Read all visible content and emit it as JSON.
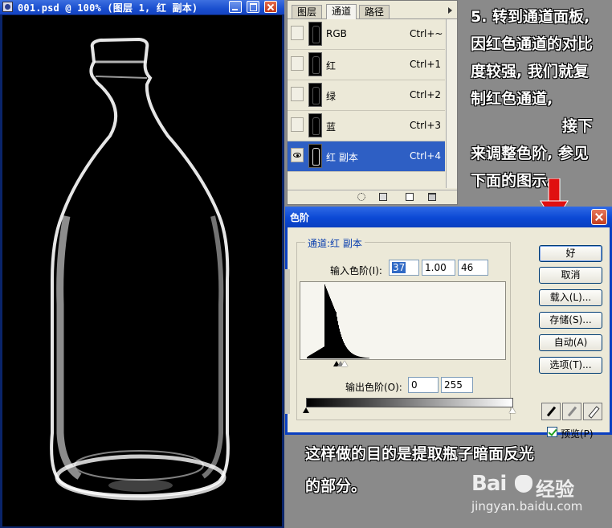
{
  "document_window": {
    "title": "001.psd @ 100% (图层 1, 红 副本)"
  },
  "channels_panel": {
    "tabs": [
      "图层",
      "通道",
      "路径"
    ],
    "active_tab": "通道",
    "channels": [
      {
        "name": "RGB",
        "shortcut": "Ctrl+~",
        "visible": false,
        "selected": false
      },
      {
        "name": "红",
        "shortcut": "Ctrl+1",
        "visible": false,
        "selected": false
      },
      {
        "name": "绿",
        "shortcut": "Ctrl+2",
        "visible": false,
        "selected": false
      },
      {
        "name": "蓝",
        "shortcut": "Ctrl+3",
        "visible": false,
        "selected": false
      },
      {
        "name": "红 副本",
        "shortcut": "Ctrl+4",
        "visible": true,
        "selected": true
      }
    ]
  },
  "levels_dialog": {
    "title": "色阶",
    "channel_label": "通道:红 副本",
    "input_levels_label": "输入色阶(I):",
    "input_levels": [
      "37",
      "1.00",
      "46"
    ],
    "output_levels_label": "输出色阶(O):",
    "output_levels": [
      "0",
      "255"
    ],
    "buttons": {
      "ok": "好",
      "cancel": "取消",
      "load": "载入(L)...",
      "save": "存储(S)...",
      "auto": "自动(A)",
      "options": "选项(T)..."
    },
    "preview_label": "预览(P)",
    "preview_checked": true,
    "histogram_hint": "dark-heavy"
  },
  "annotation": {
    "top_lines": [
      "5. 转到通道面板,",
      "因红色通道的对比",
      "度较强, 我们就复",
      "制红色通道,",
      "接下",
      "来调整色阶, 参见",
      "下面的图示。"
    ],
    "bottom_lines": [
      "这样做的目的是提取瓶子暗面反光",
      "的部分。"
    ]
  },
  "watermark": {
    "brand": "Bai",
    "brand_suffix": "du",
    "product": "经验",
    "url": "jingyan.baidu.com"
  },
  "colors": {
    "titlebar_blue": "#0b48d4",
    "selection_blue": "#2e5fc4",
    "annotation_bg": "#8a8a8a",
    "arrow_red": "#e01010"
  }
}
